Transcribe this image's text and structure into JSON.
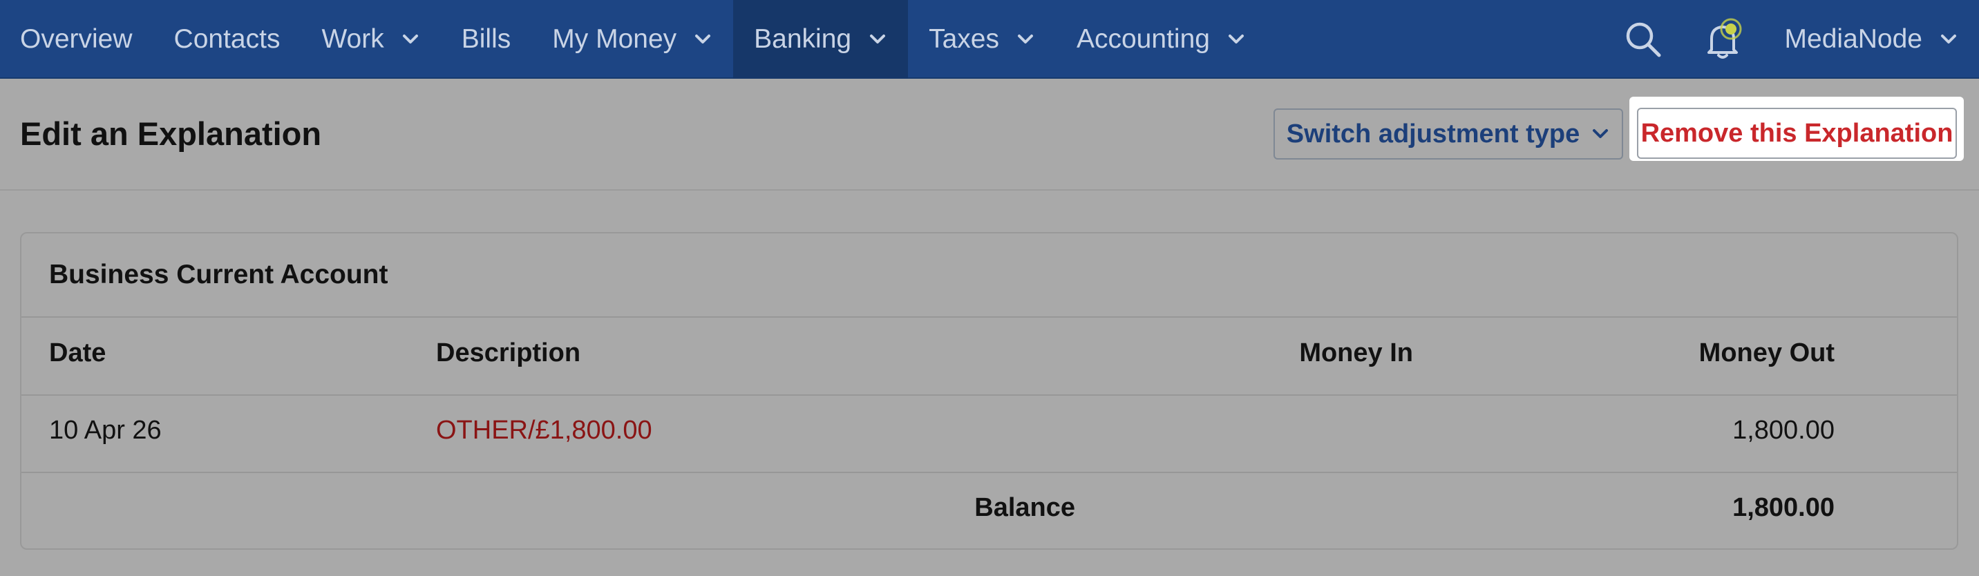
{
  "nav": {
    "items": [
      {
        "label": "Overview",
        "has_dropdown": false,
        "active": false
      },
      {
        "label": "Contacts",
        "has_dropdown": false,
        "active": false
      },
      {
        "label": "Work",
        "has_dropdown": true,
        "active": false
      },
      {
        "label": "Bills",
        "has_dropdown": false,
        "active": false
      },
      {
        "label": "My Money",
        "has_dropdown": true,
        "active": false
      },
      {
        "label": "Banking",
        "has_dropdown": true,
        "active": true
      },
      {
        "label": "Taxes",
        "has_dropdown": true,
        "active": false
      },
      {
        "label": "Accounting",
        "has_dropdown": true,
        "active": false
      }
    ],
    "account_name": "MediaNode"
  },
  "icons": {
    "search": "search-icon",
    "notifications": "bell-icon",
    "dropdown": "chevron-down-icon"
  },
  "page": {
    "title": "Edit an Explanation",
    "switch_button": "Switch adjustment type",
    "remove_button": "Remove this Explanation"
  },
  "card": {
    "title": "Business Current Account",
    "columns": {
      "date": "Date",
      "description": "Description",
      "money_in": "Money In",
      "money_out": "Money Out"
    },
    "rows": [
      {
        "date": "10 Apr 26",
        "description": "OTHER/£1,800.00",
        "money_in": "",
        "money_out": "1,800.00"
      }
    ],
    "footer": {
      "label": "Balance",
      "value": "1,800.00"
    }
  },
  "colors": {
    "nav_bg": "#1d4584",
    "nav_active_bg": "#163769",
    "remove_red": "#c9272b",
    "link_red": "#8a1414",
    "notification_dot": "#c8d24b"
  }
}
